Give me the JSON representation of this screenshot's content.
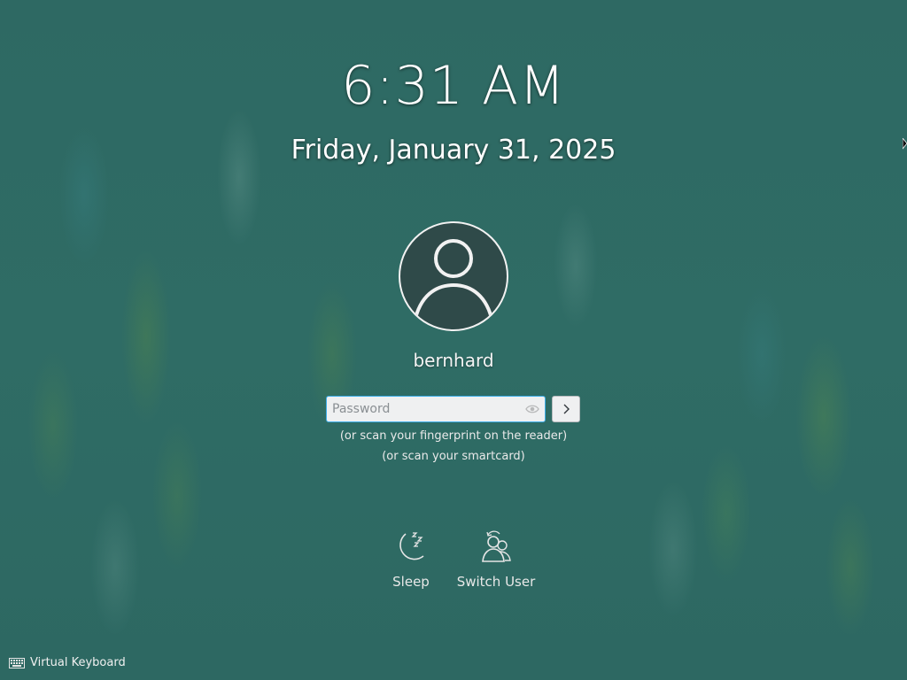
{
  "lockscreen": {
    "time": "6:31 AM",
    "date": "Friday, January 31, 2025"
  },
  "user": {
    "name": "bernhard",
    "avatar_icon": "user-avatar-icon"
  },
  "password": {
    "placeholder": "Password",
    "value": "",
    "reveal_icon": "eye-icon",
    "submit_icon": "chevron-right-icon"
  },
  "hints": {
    "fingerprint": "(or scan your fingerprint on the reader)",
    "smartcard": "(or scan your smartcard)"
  },
  "actions": {
    "sleep_label": "Sleep",
    "sleep_icon": "sleep-moon-icon",
    "switch_user_label": "Switch User",
    "switch_user_icon": "switch-user-icon"
  },
  "footer": {
    "virtual_keyboard_label": "Virtual Keyboard",
    "virtual_keyboard_icon": "keyboard-icon"
  },
  "colors": {
    "background": "#2f6a63",
    "accent": "#3daee9",
    "avatar_bg": "#2f4a49"
  }
}
